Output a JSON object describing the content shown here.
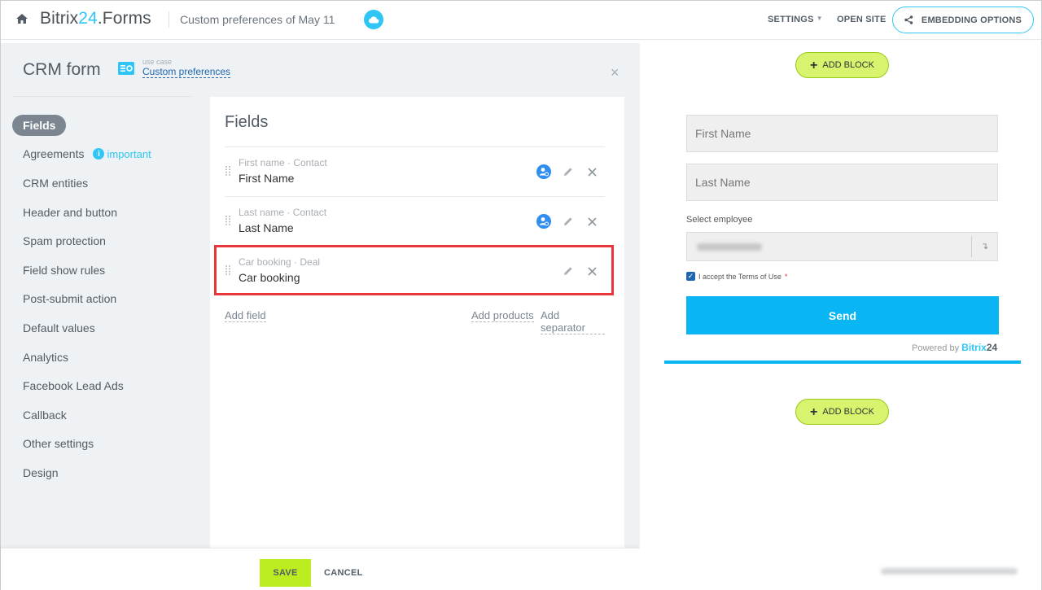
{
  "header": {
    "brand_text": "Bitrix",
    "brand_num": "24",
    "brand_suffix": ".Forms",
    "page_title": "Custom preferences of May 11",
    "settings_label": "SETTINGS",
    "open_site_label": "OPEN SITE",
    "embedding_label": "EMBEDDING OPTIONS"
  },
  "panel": {
    "title": "CRM form",
    "use_case_label": "use case",
    "use_case_link": "Custom preferences",
    "close_glyph": "×"
  },
  "nav": {
    "items": [
      {
        "label": "Fields"
      },
      {
        "label": "Agreements",
        "badge": "important"
      },
      {
        "label": "CRM entities"
      },
      {
        "label": "Header and button"
      },
      {
        "label": "Spam protection"
      },
      {
        "label": "Field show rules"
      },
      {
        "label": "Post-submit action"
      },
      {
        "label": "Default values"
      },
      {
        "label": "Analytics"
      },
      {
        "label": "Facebook Lead Ads"
      },
      {
        "label": "Callback"
      },
      {
        "label": "Other settings"
      },
      {
        "label": "Design"
      }
    ]
  },
  "fields": {
    "heading": "Fields",
    "rows": [
      {
        "meta": "First name · Contact",
        "name": "First Name"
      },
      {
        "meta": "Last name · Contact",
        "name": "Last Name"
      },
      {
        "meta": "Car booking · Deal",
        "name": "Car booking"
      }
    ],
    "add_field": "Add field",
    "add_products": "Add products",
    "add_separator": "Add separator"
  },
  "footer": {
    "save_label": "SAVE",
    "cancel_label": "CANCEL"
  },
  "preview": {
    "add_block_label": "ADD BLOCK",
    "first_name_placeholder": "First Name",
    "last_name_placeholder": "Last Name",
    "select_label": "Select employee",
    "terms_text": "I accept the Terms of Use",
    "terms_required": "*",
    "send_label": "Send",
    "powered_by": "Powered by",
    "powered_brand": "Bitrix",
    "powered_num": "24"
  },
  "colors": {
    "accent": "#2fc6f6",
    "save_green": "#bbed21",
    "send_blue": "#0ab5f3",
    "highlight_red": "#e8373b"
  }
}
